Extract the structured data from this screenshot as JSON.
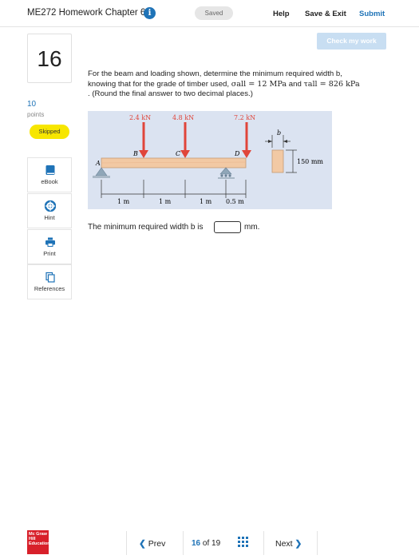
{
  "header": {
    "title": "ME272 Homework Chapter 6",
    "info_icon": "info-icon",
    "saved_label": "Saved",
    "help_label": "Help",
    "save_exit_label": "Save & Exit",
    "submit_label": "Submit"
  },
  "check_my_work_label": "Check my work",
  "question": {
    "number": "16",
    "points_value": "10",
    "points_label": "points",
    "status_badge": "Skipped",
    "text_line1": "For the beam and loading shown, determine the minimum required width b,",
    "text_line2_a": "knowing that for the grade of timber used, ",
    "sigma_all": "σall = 12 MPa",
    "text_and": " and ",
    "tau_all": "τall = 826 kPa",
    "text_line3": ". (Round the final answer to two decimal places.)",
    "answer_prompt": "The minimum required width b is",
    "answer_value": "",
    "answer_unit": "mm."
  },
  "figure": {
    "loads": [
      "2.4 kN",
      "4.8 kN",
      "7.2 kN"
    ],
    "points": [
      "A",
      "B",
      "C",
      "D"
    ],
    "spans": [
      "1 m",
      "1 m",
      "1 m",
      "0.5 m"
    ],
    "width_label": "b",
    "height_label": "150 mm"
  },
  "rail": {
    "items": [
      {
        "label": "eBook",
        "icon": "book-icon"
      },
      {
        "label": "Hint",
        "icon": "lifebuoy-icon"
      },
      {
        "label": "Print",
        "icon": "printer-icon"
      },
      {
        "label": "References",
        "icon": "documents-icon"
      }
    ]
  },
  "footer": {
    "logo_text": "Mc Graw Hill Education",
    "prev_label": "Prev",
    "current_page": "16",
    "of_label": "of",
    "total_pages": "19",
    "next_label": "Next"
  },
  "colors": {
    "accent": "#1f73b7",
    "skipped_badge": "#f7e600",
    "load_arrow": "#e0453a",
    "figure_bg": "#dbe3f1",
    "beam": "#f2c9a4"
  }
}
